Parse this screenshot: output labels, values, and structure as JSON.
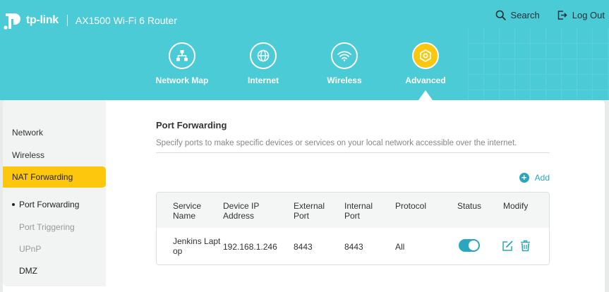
{
  "brand": {
    "logo_text": "tp-link",
    "model": "AX1500 Wi-Fi 6 Router"
  },
  "top_actions": {
    "search_label": "Search",
    "logout_label": "Log Out"
  },
  "nav": {
    "items": [
      {
        "label": "Network Map",
        "icon": "network-map-icon"
      },
      {
        "label": "Internet",
        "icon": "globe-icon"
      },
      {
        "label": "Wireless",
        "icon": "wifi-icon"
      },
      {
        "label": "Advanced",
        "icon": "advanced-gear-icon",
        "active": true
      }
    ]
  },
  "sidebar": {
    "items": [
      {
        "label": "Network"
      },
      {
        "label": "Wireless"
      },
      {
        "label": "NAT Forwarding",
        "active": true
      },
      {
        "label": "Port Forwarding",
        "sub": true,
        "current": true
      },
      {
        "label": "Port Triggering",
        "sub": true
      },
      {
        "label": "UPnP",
        "sub": true
      },
      {
        "label": "DMZ",
        "sub": true
      }
    ]
  },
  "page": {
    "title": "Port Forwarding",
    "description": "Specify ports to make specific devices or services on your local network accessible over the internet.",
    "add_label": "Add"
  },
  "table": {
    "headers": {
      "service_name": "Service Name",
      "device_ip": "Device IP Address",
      "external_port": "External Port",
      "internal_port": "Internal Port",
      "protocol": "Protocol",
      "status": "Status",
      "modify": "Modify"
    },
    "rows": [
      {
        "service_name": "Jenkins Laptop",
        "device_ip": "192.168.1.246",
        "external_port": "8443",
        "internal_port": "8443",
        "protocol": "All",
        "status": "on"
      }
    ]
  },
  "colors": {
    "header_bg": "#4acbd6",
    "accent": "#fcc70c",
    "link": "#2aa6c0"
  }
}
